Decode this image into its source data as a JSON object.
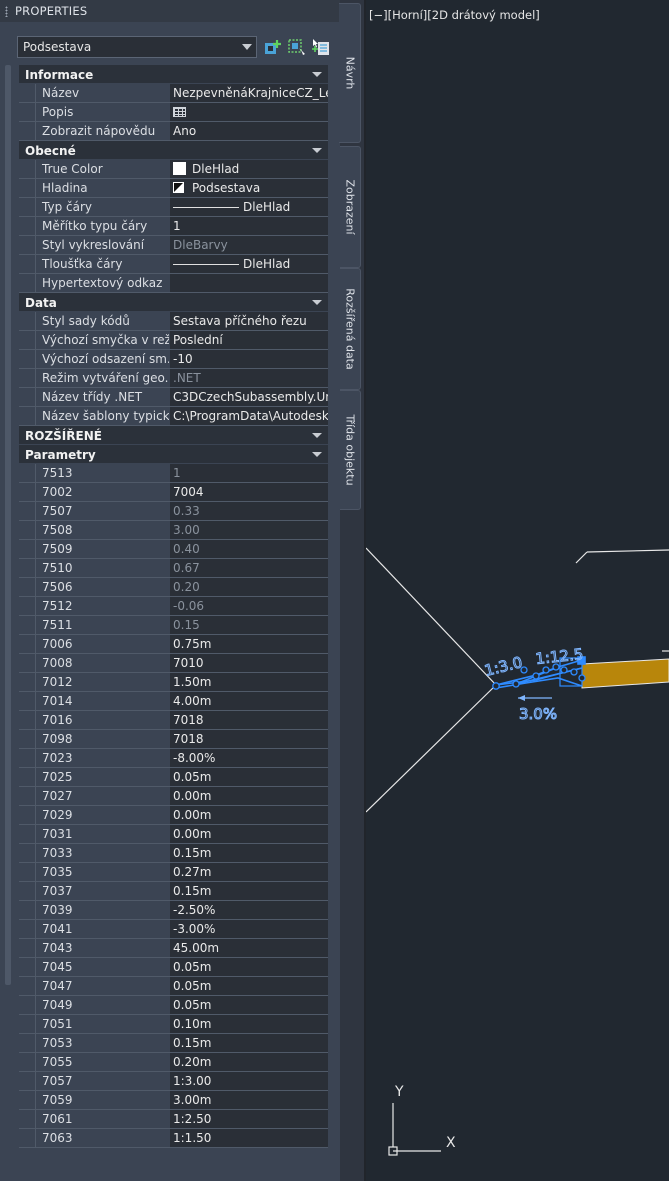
{
  "palette": {
    "title": "PROPERTIES",
    "selector": {
      "value": "Podsestava"
    },
    "toolbar_icons": [
      "quick-select-icon",
      "select-objects-icon",
      "toggle-pickadd-icon"
    ],
    "categories": [
      {
        "label": "Informace",
        "rows": [
          {
            "key": "Název",
            "value": "NezpevněnáKrajniceCZ_Levy"
          },
          {
            "key": "Popis",
            "value": "",
            "icon": "table-icon"
          },
          {
            "key": "Zobrazit nápovědu",
            "value": "Ano"
          }
        ]
      },
      {
        "label": "Obecné",
        "rows": [
          {
            "key": "True Color",
            "value": "DleHlad",
            "icon": "color-swatch-icon"
          },
          {
            "key": "Hladina",
            "value": "Podsestava",
            "icon": "layer-icon"
          },
          {
            "key": "Typ čáry",
            "value": "DleHlad",
            "icon": "linetype-icon"
          },
          {
            "key": "Měřítko typu čáry",
            "value": "1"
          },
          {
            "key": "Styl vykreslování",
            "value": "DleBarvy",
            "dim": true
          },
          {
            "key": "Tloušťka čáry",
            "value": "DleHlad",
            "icon": "linetype-icon"
          },
          {
            "key": "Hypertextový odkaz",
            "value": ""
          }
        ]
      },
      {
        "label": "Data",
        "rows": [
          {
            "key": "Styl sady kódů",
            "value": "Sestava příčného řezu"
          },
          {
            "key": "Výchozí smyčka v rež...",
            "value": "Poslední"
          },
          {
            "key": "Výchozí odsazení sm...",
            "value": "-10"
          },
          {
            "key": "Režim vytváření geo...",
            "value": ".NET",
            "dim": true
          },
          {
            "key": "Název třídy .NET",
            "value": "C3DCzechSubassembly.Un..."
          },
          {
            "key": "Název šablony typick...",
            "value": "C:\\ProgramData\\Autodesk..."
          }
        ]
      },
      {
        "label": "ROZŠÍŘENÉ",
        "rows": []
      },
      {
        "label": "Parametry",
        "rows": [
          {
            "key": "7513",
            "value": "1",
            "dim": true
          },
          {
            "key": "7002",
            "value": "7004"
          },
          {
            "key": "7507",
            "value": "0.33",
            "dim": true
          },
          {
            "key": "7508",
            "value": "3.00",
            "dim": true
          },
          {
            "key": "7509",
            "value": "0.40",
            "dim": true
          },
          {
            "key": "7510",
            "value": "0.67",
            "dim": true
          },
          {
            "key": "7506",
            "value": "0.20",
            "dim": true
          },
          {
            "key": "7512",
            "value": "-0.06",
            "dim": true
          },
          {
            "key": "7511",
            "value": "0.15",
            "dim": true
          },
          {
            "key": "7006",
            "value": "0.75m"
          },
          {
            "key": "7008",
            "value": "7010"
          },
          {
            "key": "7012",
            "value": "1.50m"
          },
          {
            "key": "7014",
            "value": "4.00m"
          },
          {
            "key": "7016",
            "value": "7018"
          },
          {
            "key": "7098",
            "value": "7018"
          },
          {
            "key": "7023",
            "value": "-8.00%"
          },
          {
            "key": "7025",
            "value": "0.05m"
          },
          {
            "key": "7027",
            "value": "0.00m"
          },
          {
            "key": "7029",
            "value": "0.00m"
          },
          {
            "key": "7031",
            "value": "0.00m"
          },
          {
            "key": "7033",
            "value": "0.15m"
          },
          {
            "key": "7035",
            "value": "0.27m"
          },
          {
            "key": "7037",
            "value": "0.15m"
          },
          {
            "key": "7039",
            "value": "-2.50%"
          },
          {
            "key": "7041",
            "value": "-3.00%"
          },
          {
            "key": "7043",
            "value": "45.00m"
          },
          {
            "key": "7045",
            "value": "0.05m"
          },
          {
            "key": "7047",
            "value": "0.05m"
          },
          {
            "key": "7049",
            "value": "0.05m"
          },
          {
            "key": "7051",
            "value": "0.10m"
          },
          {
            "key": "7053",
            "value": "0.15m"
          },
          {
            "key": "7055",
            "value": "0.20m"
          },
          {
            "key": "7057",
            "value": "1:3.00"
          },
          {
            "key": "7059",
            "value": "3.00m"
          },
          {
            "key": "7061",
            "value": "1:2.50"
          },
          {
            "key": "7063",
            "value": "1:1.50"
          }
        ]
      }
    ],
    "side_tabs": [
      "Návrh",
      "Zobrazení",
      "Rozšířená data",
      "Třída objektu"
    ]
  },
  "viewport": {
    "label": "[−][Horní][2D drátový model]",
    "annotations": {
      "slope_left": "1:3.0",
      "slope_right": "1:12.5",
      "grade": "3.0%"
    },
    "ucs": {
      "x": "X",
      "y": "Y"
    },
    "colors": {
      "selection": "#2e8bff",
      "fill": "#b8860b",
      "lines": "#e8e8e8"
    }
  }
}
